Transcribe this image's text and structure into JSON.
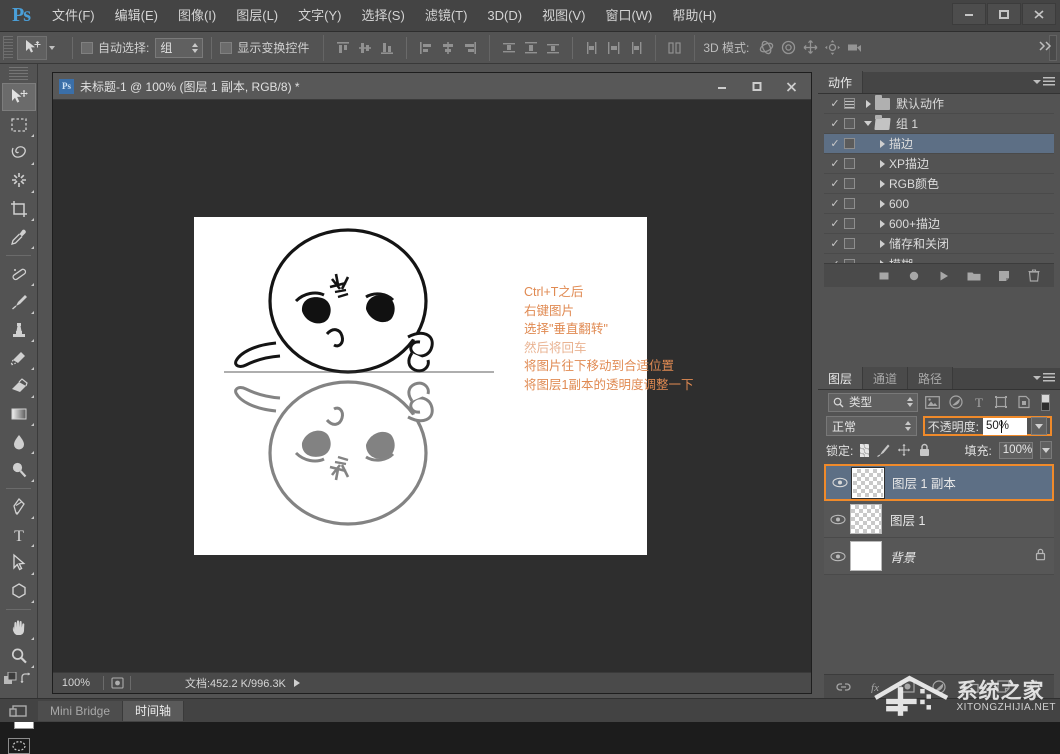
{
  "app": {
    "logo": "Ps",
    "menus": [
      {
        "label": "文件(F)"
      },
      {
        "label": "编辑(E)"
      },
      {
        "label": "图像(I)"
      },
      {
        "label": "图层(L)"
      },
      {
        "label": "文字(Y)"
      },
      {
        "label": "选择(S)"
      },
      {
        "label": "滤镜(T)"
      },
      {
        "label": "3D(D)"
      },
      {
        "label": "视图(V)"
      },
      {
        "label": "窗口(W)"
      },
      {
        "label": "帮助(H)"
      }
    ],
    "window_controls": {
      "minimize": "—",
      "maximize": "▭",
      "close": "✕"
    }
  },
  "options_bar": {
    "auto_select_label": "自动选择:",
    "auto_select_value": "组",
    "show_transform_label": "显示变换控件",
    "mode3d_label": "3D 模式:"
  },
  "toolbar": {
    "tools": [
      {
        "name": "move-tool",
        "selected": true
      },
      {
        "name": "marquee-tool",
        "selected": false
      },
      {
        "name": "lasso-tool",
        "selected": false
      },
      {
        "name": "magic-wand-tool",
        "selected": false
      },
      {
        "name": "crop-tool",
        "selected": false
      },
      {
        "name": "eyedropper-tool",
        "selected": false
      },
      {
        "name": "healing-brush-tool",
        "selected": false
      },
      {
        "name": "brush-tool",
        "selected": false
      },
      {
        "name": "clone-stamp-tool",
        "selected": false
      },
      {
        "name": "history-brush-tool",
        "selected": false
      },
      {
        "name": "eraser-tool",
        "selected": false
      },
      {
        "name": "gradient-tool",
        "selected": false
      },
      {
        "name": "blur-tool",
        "selected": false
      },
      {
        "name": "dodge-tool",
        "selected": false
      },
      {
        "name": "pen-tool",
        "selected": false
      },
      {
        "name": "type-tool",
        "selected": false
      },
      {
        "name": "path-selection-tool",
        "selected": false
      },
      {
        "name": "shape-tool",
        "selected": false
      },
      {
        "name": "hand-tool",
        "selected": false
      },
      {
        "name": "zoom-tool",
        "selected": false
      }
    ],
    "foreground_color": "#ffffff",
    "background_color": "#ffffff"
  },
  "document": {
    "title": "未标题-1 @ 100% (图层 1 副本, RGB/8) *",
    "ps_badge": "Ps",
    "window_controls": {
      "minimize": "—",
      "maximize": "▭",
      "close": "✕"
    },
    "status": {
      "zoom": "100%",
      "doc_label": "文档:452.2 K/996.3K"
    },
    "annotation_lines": [
      "Ctrl+T之后",
      "右键图片",
      "选择\"垂直翻转\"",
      "然后将回车",
      "将图片往下移动到合适位置",
      "将图层1副本的透明度调整一下"
    ],
    "annotation_color": "#e08a52"
  },
  "actions_panel": {
    "tab": "动作",
    "rows": [
      {
        "check": "✓",
        "box": "lines",
        "arrow": "closed",
        "folder": true,
        "label": "默认动作",
        "indent": 0,
        "selected": false
      },
      {
        "check": "✓",
        "box": "empty",
        "arrow": "open",
        "folder": true,
        "label": "组 1",
        "indent": 0,
        "selected": false
      },
      {
        "check": "✓",
        "box": "empty",
        "arrow": "closed",
        "folder": false,
        "label": "描边",
        "indent": 1,
        "selected": true
      },
      {
        "check": "✓",
        "box": "empty",
        "arrow": "closed",
        "folder": false,
        "label": "XP描边",
        "indent": 1,
        "selected": false
      },
      {
        "check": "✓",
        "box": "empty",
        "arrow": "closed",
        "folder": false,
        "label": "RGB颜色",
        "indent": 1,
        "selected": false
      },
      {
        "check": "✓",
        "box": "empty",
        "arrow": "closed",
        "folder": false,
        "label": "600",
        "indent": 1,
        "selected": false
      },
      {
        "check": "✓",
        "box": "empty",
        "arrow": "closed",
        "folder": false,
        "label": "600+描边",
        "indent": 1,
        "selected": false
      },
      {
        "check": "✓",
        "box": "empty",
        "arrow": "closed",
        "folder": false,
        "label": "储存和关闭",
        "indent": 1,
        "selected": false
      },
      {
        "check": "✓",
        "box": "empty",
        "arrow": "closed",
        "folder": false,
        "label": "模糊",
        "indent": 1,
        "selected": false
      }
    ],
    "footer_buttons": [
      "stop-button",
      "record-button",
      "play-button",
      "new-set-button",
      "new-action-button",
      "delete-button"
    ]
  },
  "layers_panel": {
    "tabs": [
      {
        "label": "图层",
        "active": true
      },
      {
        "label": "通道",
        "active": false
      },
      {
        "label": "路径",
        "active": false
      }
    ],
    "filter_value": "类型",
    "blend_mode": "正常",
    "opacity_label": "不透明度:",
    "opacity_value": "50%",
    "fill_label": "填充:",
    "fill_value": "100%",
    "lock_label": "锁定:",
    "highlight_color": "#f08a2a",
    "layers": [
      {
        "name": "图层 1 副本",
        "visible": true,
        "selected": true,
        "highlighted": true,
        "thumb": "checker",
        "locked": false,
        "italic": false
      },
      {
        "name": "图层 1",
        "visible": true,
        "selected": false,
        "highlighted": false,
        "thumb": "checker",
        "locked": false,
        "italic": false
      },
      {
        "name": "背景",
        "visible": true,
        "selected": false,
        "highlighted": false,
        "thumb": "white",
        "locked": true,
        "italic": true
      }
    ],
    "footer_buttons": [
      "link-button",
      "fx-button",
      "mask-button",
      "adjustment-button",
      "group-button",
      "new-layer-button",
      "delete-layer-button"
    ]
  },
  "bottom_bar": {
    "tabs": [
      {
        "label": "Mini Bridge",
        "active": false
      },
      {
        "label": "时间轴",
        "active": true
      }
    ]
  },
  "watermark": {
    "title": "系统之家",
    "subtitle": "XITONGZHIJIA.NET"
  }
}
